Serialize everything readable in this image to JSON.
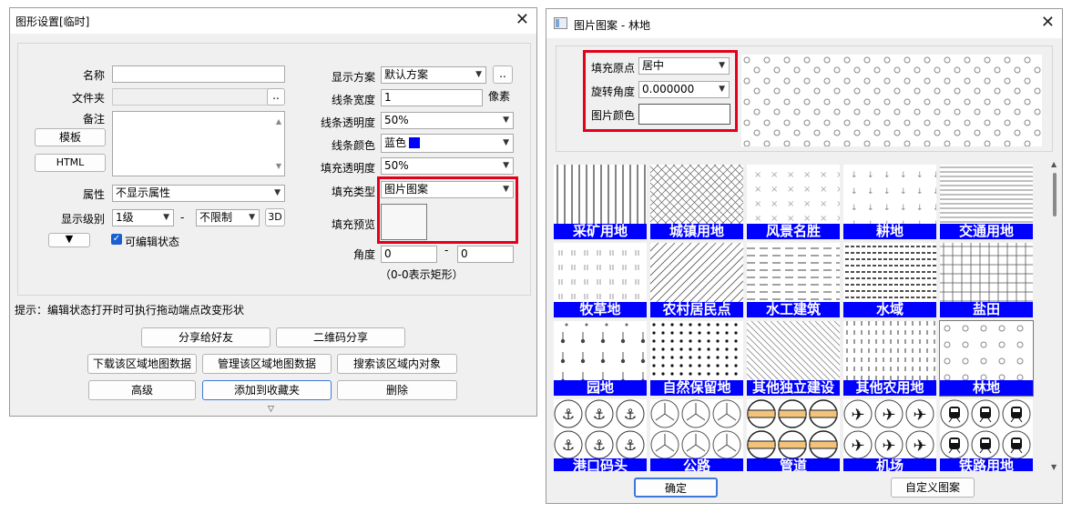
{
  "left": {
    "title": "图形设置[临时]",
    "name_label": "名称",
    "folder_label": "文件夹",
    "folder_btn": "..",
    "note_label": "备注",
    "template_btn": "模板",
    "html_btn": "HTML",
    "attr_label": "属性",
    "attr_value": "不显示属性",
    "level_label": "显示级别",
    "level_from": "1级",
    "level_dash": "-",
    "level_to": "不限制",
    "btn_3d": "3D",
    "editable_label": "可编辑状态",
    "scheme_label": "显示方案",
    "scheme_value": "默认方案",
    "scheme_btn": "..",
    "line_width_label": "线条宽度",
    "line_width_value": "1",
    "line_width_unit": "像素",
    "line_opacity_label": "线条透明度",
    "line_opacity_value": "50%",
    "line_color_label": "线条颜色",
    "line_color_value": "蓝色",
    "fill_opacity_label": "填充透明度",
    "fill_opacity_value": "50%",
    "fill_type_label": "填充类型",
    "fill_type_value": "图片图案",
    "fill_preview_label": "填充预览",
    "angle_label": "角度",
    "angle_from": "0",
    "angle_dash": "-",
    "angle_to": "0",
    "angle_hint": "（0-0表示矩形）",
    "tip": "提示：编辑状态打开时可执行拖动端点改变形状",
    "share_btn": "分享给好友",
    "qr_btn": "二维码分享",
    "download_btn": "下载该区域地图数据",
    "manage_btn": "管理该区域地图数据",
    "search_btn": "搜索该区域内对象",
    "advanced_btn": "高级",
    "favorite_btn": "添加到收藏夹",
    "delete_btn": "删除",
    "colors": {
      "line_color": "#0000ff",
      "highlight": "#e3001b"
    }
  },
  "right": {
    "title": "图片图案 - 林地",
    "origin_label": "填充原点",
    "origin_value": "居中",
    "rotate_label": "旋转角度",
    "rotate_value": "0.000000",
    "color_label": "图片颜色",
    "ok_btn": "确定",
    "custom_btn": "自定义图案",
    "patterns": [
      {
        "label": "采矿用地",
        "pattern": "vlines"
      },
      {
        "label": "城镇用地",
        "pattern": "crosshatch"
      },
      {
        "label": "风景名胜",
        "pattern": "xmarks"
      },
      {
        "label": "耕地",
        "pattern": "arrows"
      },
      {
        "label": "交通用地",
        "pattern": "hlines"
      },
      {
        "label": "牧草地",
        "pattern": "ticks"
      },
      {
        "label": "农村居民点",
        "pattern": "diag"
      },
      {
        "label": "水工建筑",
        "pattern": "dashes"
      },
      {
        "label": "水域",
        "pattern": "dashrows"
      },
      {
        "label": "盐田",
        "pattern": "grid"
      },
      {
        "label": "园地",
        "pattern": "pins"
      },
      {
        "label": "自然保留地",
        "pattern": "dots"
      },
      {
        "label": "其他独立建设",
        "pattern": "diag2"
      },
      {
        "label": "其他农用地",
        "pattern": "vdash"
      },
      {
        "label": "林地",
        "pattern": "circles"
      },
      {
        "label": "港口码头",
        "pattern": "anchor"
      },
      {
        "label": "公路",
        "pattern": "fan"
      },
      {
        "label": "管道",
        "pattern": "pipe"
      },
      {
        "label": "机场",
        "pattern": "plane"
      },
      {
        "label": "铁路用地",
        "pattern": "train"
      }
    ]
  }
}
